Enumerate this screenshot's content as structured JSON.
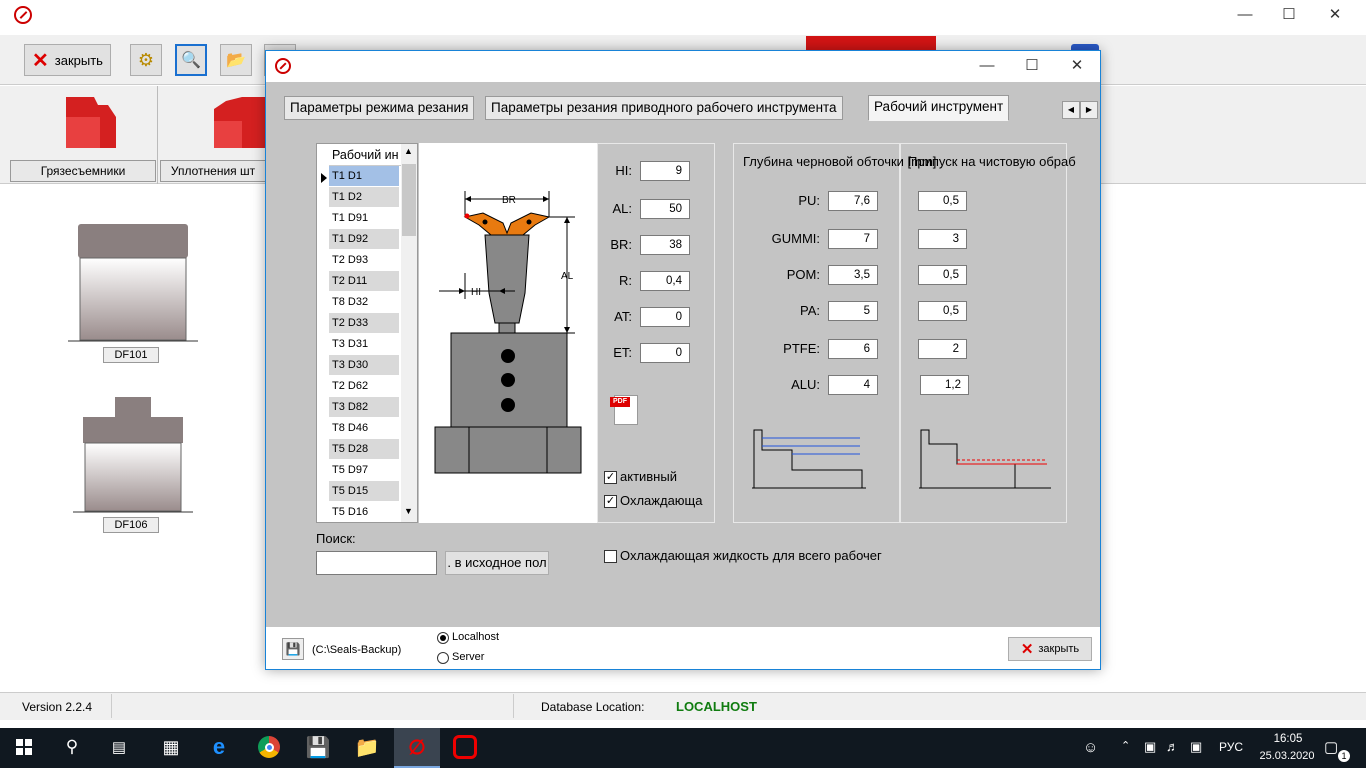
{
  "main_window": {
    "close_button": "закрыть",
    "categories": [
      "Грязесъемники",
      "Уплотнения шт"
    ],
    "products": [
      "DF101",
      "DF106"
    ],
    "status": {
      "version": "Version 2.2.4",
      "db_label": "Database Location:",
      "db_value": "LOCALHOST"
    }
  },
  "dialog": {
    "tabs": [
      "Параметры режима резания",
      "Параметры резания приводного рабочего инструмента",
      "Рабочий инструмент"
    ],
    "tool_list": {
      "header": "Рабочий ин",
      "items": [
        "T1 D1",
        "T1 D2",
        "T1 D91",
        "T1 D92",
        "T2 D93",
        "T2 D11",
        "T8 D32",
        "T2 D33",
        "T3 D31",
        "T3 D30",
        "T2 D62",
        "T3 D82",
        "T8 D46",
        "T5 D28",
        "T5 D97",
        "T5 D15",
        "T5 D16"
      ],
      "selected_index": 0
    },
    "diagram_labels": {
      "br": "BR",
      "al": "AL",
      "hi": "HI"
    },
    "params": [
      {
        "label": "HI:",
        "value": "9"
      },
      {
        "label": "AL:",
        "value": "50"
      },
      {
        "label": "BR:",
        "value": "38"
      },
      {
        "label": "R:",
        "value": "0,4"
      },
      {
        "label": "AT:",
        "value": "0"
      },
      {
        "label": "ET:",
        "value": "0"
      }
    ],
    "checkbox_active": "активный",
    "checkbox_cooling": "Охлаждающа",
    "depth_header_rough": "Глубина черновой обточки [mm]",
    "depth_header_finish": "Припуск на чистовую обраб",
    "materials": [
      {
        "name": "PU:",
        "rough": "7,6",
        "finish": "0,5"
      },
      {
        "name": "GUMMI:",
        "rough": "7",
        "finish": "3"
      },
      {
        "name": "POM:",
        "rough": "3,5",
        "finish": "0,5"
      },
      {
        "name": "PA:",
        "rough": "5",
        "finish": "0,5"
      },
      {
        "name": "PTFE:",
        "rough": "6",
        "finish": "2"
      },
      {
        "name": "ALU:",
        "rough": "4",
        "finish": "1,2"
      }
    ],
    "search_label": "Поиск:",
    "search_value": "",
    "reset_button": ". в исходное пол",
    "coolant_all": "Охлаждающая жидкость для всего рабочег",
    "backup_path": "(C:\\Seals-Backup)",
    "radio_localhost": "Localhost",
    "radio_server": "Server",
    "close_button": "закрыть"
  },
  "taskbar": {
    "lang": "РУС",
    "time": "16:05",
    "date": "25.03.2020",
    "notifications": "1"
  },
  "colors": {
    "accent": "#1883d7",
    "db_value": "#107c10",
    "body": "#c4c4c4"
  }
}
